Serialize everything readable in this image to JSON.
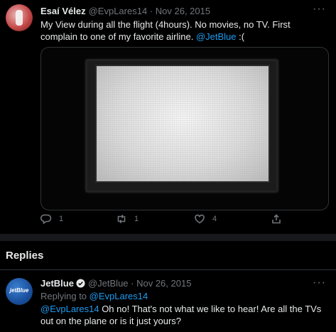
{
  "tweet": {
    "author_name": "Esaí Vélez",
    "handle": "@EvpLares14",
    "separator": " · ",
    "date": "Nov 26, 2015",
    "more_label": "···",
    "text_before": "My View during all the flight (4hours). No movies, no TV. First complain to one of my favorite airline. ",
    "mention": "@JetBlue",
    "text_after": " :(",
    "actions": {
      "reply_count": "1",
      "retweet_count": "1",
      "like_count": "4"
    }
  },
  "replies_section": {
    "title": "Replies"
  },
  "reply": {
    "author_name": "JetBlue",
    "avatar_text": "jetBlue",
    "handle": "@JetBlue",
    "separator": " · ",
    "date": "Nov 26, 2015",
    "more_label": "···",
    "replying_to_label": "Replying to ",
    "replying_to_handle": "@EvpLares14",
    "mention": "@EvpLares14",
    "text": " Oh no! That's not what we like to hear! Are all the TVs out on the plane or is it just yours?"
  },
  "colors": {
    "background": "#000000",
    "link": "#1d9bf0",
    "muted": "#71767b",
    "text": "#e7e9ea"
  },
  "icons": [
    "reply-icon",
    "retweet-icon",
    "like-icon",
    "share-icon",
    "verified-badge-icon",
    "more-icon"
  ]
}
